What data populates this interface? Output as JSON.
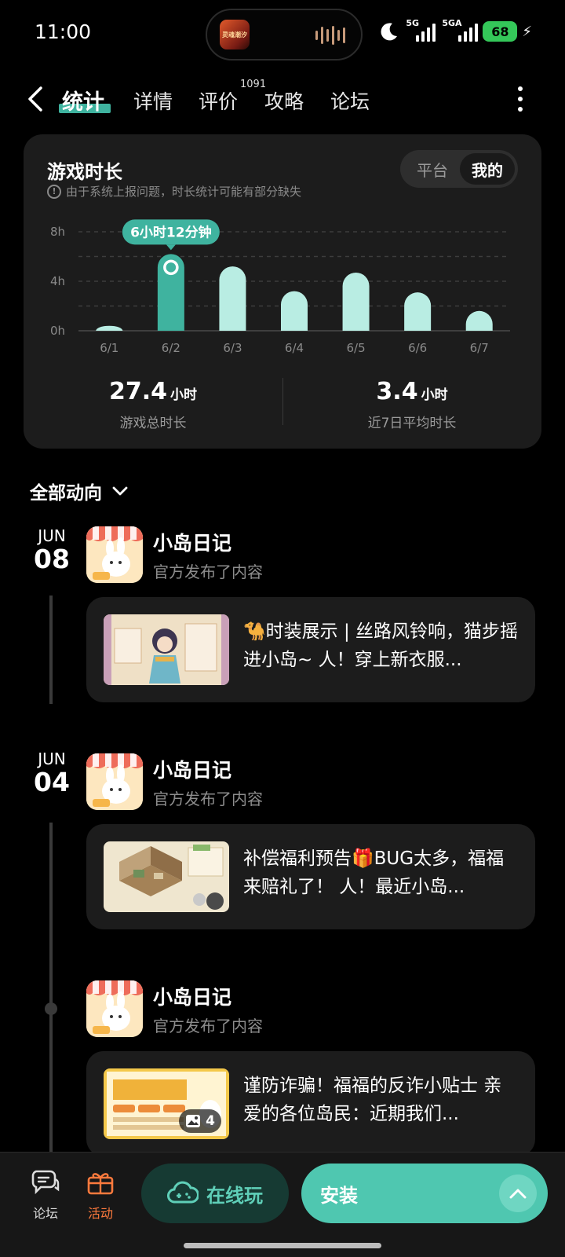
{
  "status_bar": {
    "time": "11:00",
    "island_app_label": "灵魂潮汐",
    "sim1": "5G",
    "sim2": "5GA",
    "battery": "68"
  },
  "nav": {
    "tabs": [
      {
        "label": "统计",
        "active": true
      },
      {
        "label": "详情"
      },
      {
        "label": "评价",
        "badge": "1091"
      },
      {
        "label": "攻略"
      },
      {
        "label": "论坛"
      }
    ]
  },
  "stats": {
    "title": "游戏时长",
    "note": "由于系统上报问题，时长统计可能有部分缺失",
    "toggle": {
      "platform": "平台",
      "mine": "我的",
      "selected": "我的"
    },
    "chart_data": {
      "type": "bar",
      "categories": [
        "6/1",
        "6/2",
        "6/3",
        "6/4",
        "6/5",
        "6/6",
        "6/7"
      ],
      "values": [
        0.4,
        6.2,
        5.2,
        3.2,
        4.7,
        3.1,
        1.6
      ],
      "y_ticks": [
        "0h",
        "4h",
        "8h"
      ],
      "ylim": [
        0,
        8
      ],
      "highlight_index": 1,
      "tooltip": "6小时12分钟",
      "grid": true,
      "accent": "#3fb39f",
      "bar_color": "#b9ede3"
    },
    "summary": {
      "total_value": "27.4",
      "total_unit": "小时",
      "total_label": "游戏总时长",
      "avg_value": "3.4",
      "avg_unit": "小时",
      "avg_label": "近7日平均时长"
    }
  },
  "filter": {
    "label": "全部动向"
  },
  "feed": [
    {
      "month": "JUN",
      "day": "08",
      "poster": "小岛日记",
      "action": "官方发布了内容",
      "text": "🐪时装展示 | 丝路风铃响，猫步摇进小岛~ 人！穿上新衣服...",
      "image_count": ""
    },
    {
      "month": "JUN",
      "day": "04",
      "poster": "小岛日记",
      "action": "官方发布了内容",
      "text": "补偿福利预告🎁BUG太多，福福来赔礼了！ 人！最近小岛...",
      "image_count": ""
    },
    {
      "month": "",
      "day": "",
      "poster": "小岛日记",
      "action": "官方发布了内容",
      "text": "谨防诈骗！福福的反诈小贴士 亲爱的各位岛民：近期我们...",
      "image_count": "4"
    }
  ],
  "bottom_bar": {
    "forum": "论坛",
    "activity": "活动",
    "play_online": "在线玩",
    "install": "安装",
    "activity_color": "#ff7a3d"
  }
}
